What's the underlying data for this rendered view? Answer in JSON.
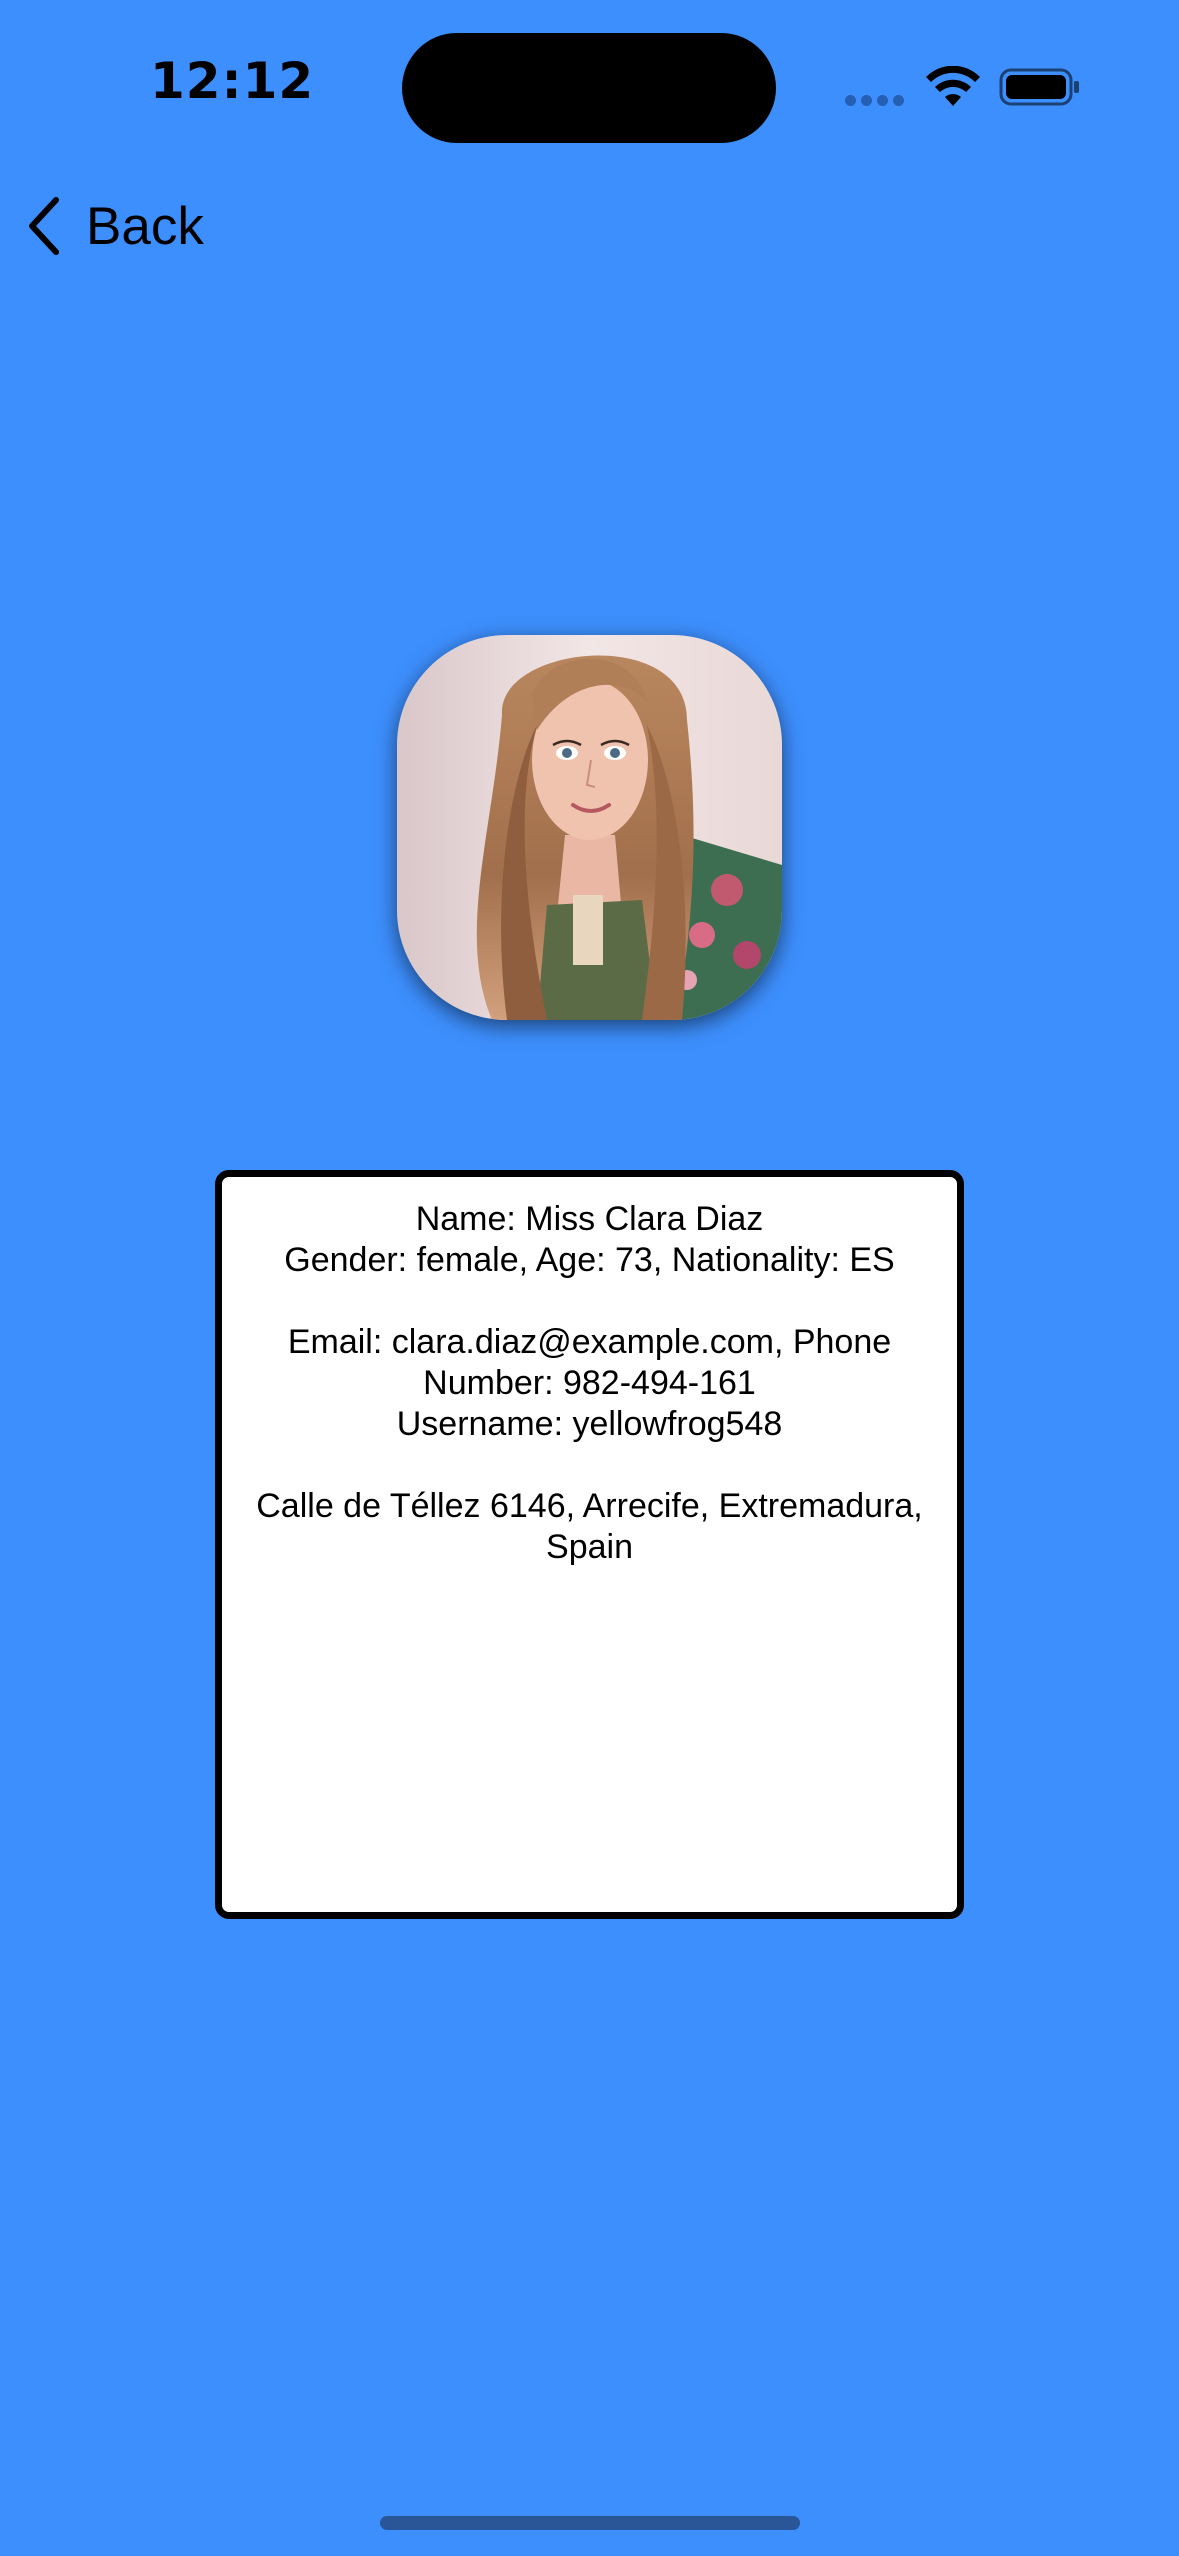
{
  "status_bar": {
    "time": "12:12"
  },
  "nav": {
    "back_label": "Back"
  },
  "profile": {
    "name_line": "Name: Miss Clara Diaz",
    "details_line": "Gender: female, Age: 73, Nationality: ES",
    "email_phone_line": "Email: clara.diaz@example.com, Phone Number: 982-494-161",
    "username_line": "Username: yellowfrog548",
    "address_line": "Calle de Téllez 6146, Arrecife, Extremadura, Spain"
  },
  "colors": {
    "background": "#3d8ffe",
    "card_background": "#ffffff",
    "card_border": "#000000"
  },
  "icons": {
    "back": "chevron-left-icon",
    "signal": "cellular-signal-icon",
    "wifi": "wifi-icon",
    "battery": "battery-icon"
  }
}
